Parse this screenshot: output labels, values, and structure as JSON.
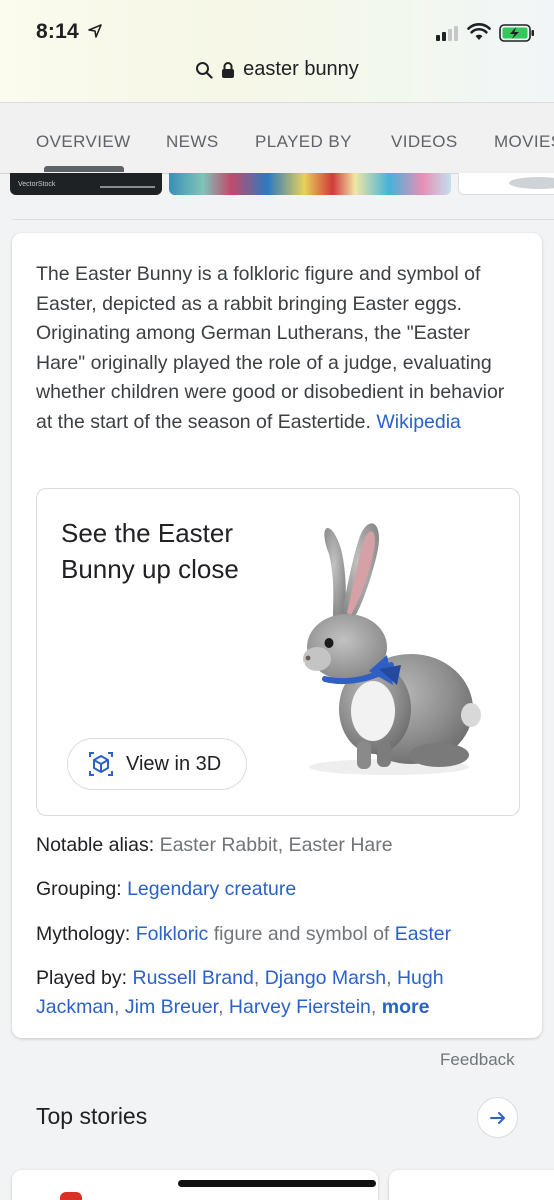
{
  "status_bar": {
    "time": "8:14"
  },
  "address_bar": {
    "query": "easter bunny"
  },
  "tabs": [
    {
      "label": "OVERVIEW"
    },
    {
      "label": "NEWS"
    },
    {
      "label": "PLAYED BY"
    },
    {
      "label": "VIDEOS"
    },
    {
      "label": "MOVIES"
    }
  ],
  "image_strip": {
    "thumb1_label": "VectorStock"
  },
  "knowledge_panel": {
    "description": "The Easter Bunny is a folkloric figure and symbol of Easter, depicted as a rabbit bringing Easter eggs. Originating among German Lutherans, the \"Easter Hare\" originally played the role of a judge, evaluating whether children were good or disobedient in behavior at the start of the season of Eastertide.",
    "source_link": "Wikipedia",
    "view3d": {
      "title": "See the Easter Bunny up close",
      "button_label": "View in 3D"
    },
    "facts": {
      "alias_label": "Notable alias:",
      "alias_value": "Easter Rabbit, Easter Hare",
      "grouping_label": "Grouping:",
      "grouping_value": "Legendary creature",
      "mythology_label": "Mythology:",
      "mythology_link1": "Folkloric",
      "mythology_text": "figure and symbol of",
      "mythology_link2": "Easter",
      "played_by_label": "Played by:",
      "played_by": [
        "Russell Brand",
        "Django Marsh",
        "Hugh Jackman",
        "Jim Breuer",
        "Harvey Fierstein"
      ],
      "more_link": "more"
    }
  },
  "feedback": "Feedback",
  "top_stories": {
    "title": "Top stories"
  },
  "colors": {
    "link": "#2a62c9",
    "muted": "#70757a",
    "bowtie": "#2f5fc4",
    "battery": "#34c759"
  }
}
